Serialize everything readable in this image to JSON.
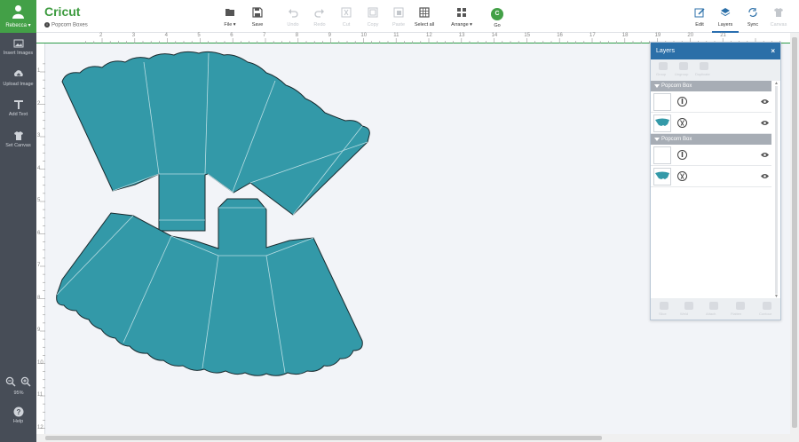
{
  "user": {
    "name": "Rebecca ▾"
  },
  "app": {
    "logo": "Cricut",
    "project_name": "Popcorn Boxes"
  },
  "sidebar": {
    "items": [
      {
        "label": "Insert Images",
        "icon": "image-icon"
      },
      {
        "label": "Upload Image",
        "icon": "upload-icon"
      },
      {
        "label": "Add Text",
        "icon": "text-icon"
      },
      {
        "label": "Set Canvas",
        "icon": "shirt-icon"
      }
    ],
    "zoom": "95%",
    "help": "Help"
  },
  "toolbar": {
    "file": "File ▾",
    "save": "Save",
    "undo": "Undo",
    "redo": "Redo",
    "cut": "Cut",
    "copy": "Copy",
    "paste": "Paste",
    "select_all": "Select all",
    "arrange": "Arrange ▾",
    "go": "Go",
    "go_letter": "C",
    "edit": "Edit",
    "layers": "Layers",
    "sync": "Sync",
    "canvas": "Canvas"
  },
  "ruler": {
    "top": [
      "2",
      "3",
      "4",
      "5",
      "6",
      "7",
      "8",
      "9",
      "10",
      "11",
      "12",
      "13",
      "14",
      "15",
      "16",
      "17",
      "18",
      "19",
      "20",
      "21"
    ],
    "left": [
      "1",
      "2",
      "3",
      "4",
      "5",
      "6",
      "7",
      "8",
      "9",
      "10",
      "11",
      "12"
    ]
  },
  "layers_panel": {
    "title": "Layers",
    "close": "×",
    "tools": [
      "Group",
      "Ungroup",
      "Duplicate"
    ],
    "groups": [
      {
        "name": "Popcorn Box",
        "rows": [
          {
            "op": "write"
          },
          {
            "op": "cut"
          }
        ]
      },
      {
        "name": "Popcorn Box",
        "rows": [
          {
            "op": "write"
          },
          {
            "op": "cut"
          }
        ]
      }
    ],
    "footer": [
      "Slice",
      "Weld",
      "Attach",
      "Flatten",
      "Contour"
    ]
  },
  "colors": {
    "shape": "#3399a8",
    "accent": "#2b6fa8",
    "brand": "#43a047"
  }
}
